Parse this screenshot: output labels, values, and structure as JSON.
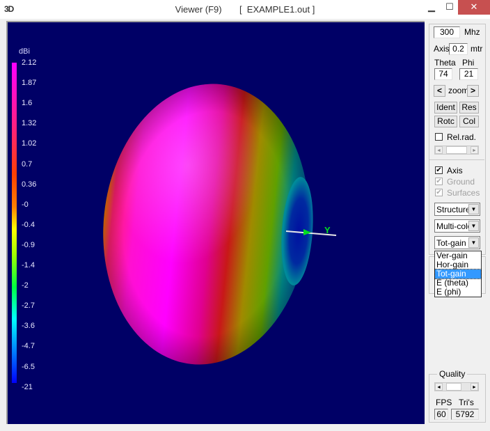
{
  "window": {
    "app_icon": "3D",
    "title": "Viewer (F9)",
    "file": "[  EXAMPLE1.out ]",
    "minimize_icon": "minimize-icon",
    "maximize_icon": "maximize-icon",
    "close_icon": "close-icon",
    "min_glyph": "▁",
    "max_glyph": "☐",
    "close_glyph": "✕"
  },
  "legend": {
    "unit": "dBi",
    "ticks": [
      "2.12",
      "1.87",
      "1.6",
      "1.32",
      "1.02",
      "0.7",
      "0.36",
      "-0",
      "-0.4",
      "-0.9",
      "-1.4",
      "-2",
      "-2.7",
      "-3.6",
      "-4.7",
      "-6.5",
      "-21"
    ]
  },
  "viewport": {
    "background": "#000066",
    "axis_label": "Y"
  },
  "panel": {
    "frequency": "300",
    "frequency_unit": "Mhz",
    "axis_label": "Axis",
    "axis_value": "0.2",
    "axis_unit": "mtr",
    "theta_label": "Theta",
    "phi_label": "Phi",
    "theta": "74",
    "phi": "21",
    "zoom_left": "<",
    "zoom_label": "zoom",
    "zoom_right": ">",
    "buttons": [
      "Ident",
      "Res",
      "Rotc",
      "Col"
    ],
    "rel_rad": {
      "label": "Rel.rad.",
      "checked": false
    },
    "checkboxes": [
      {
        "label": "Axis",
        "checked": true,
        "enabled": true
      },
      {
        "label": "Ground",
        "checked": true,
        "enabled": false
      },
      {
        "label": "Surfaces",
        "checked": true,
        "enabled": false
      }
    ],
    "selects": [
      {
        "value": "Structure"
      },
      {
        "value": "Multi-colo"
      },
      {
        "value": "Tot-gain"
      }
    ],
    "gain_options": [
      "Ver-gain",
      "Hor-gain",
      "Tot-gain",
      "E (theta)",
      "E (phi)"
    ],
    "gain_selected": "Tot-gain",
    "quality_label": "Quality",
    "fps_label": "FPS",
    "tris_label": "Tri's",
    "fps": "60",
    "tris": "5792",
    "check_glyph": "✔",
    "arrow_down": "▼",
    "arrow_left": "◄",
    "arrow_right": "►"
  }
}
